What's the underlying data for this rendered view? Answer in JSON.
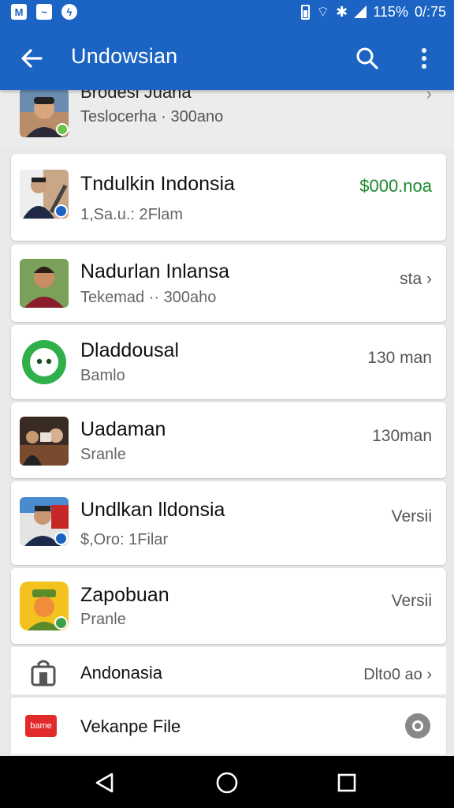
{
  "status_bar": {
    "battery": "115%",
    "time": "0/:75"
  },
  "app_bar": {
    "title": "Undowsian"
  },
  "background_item": {
    "name": "Brodesi Juana",
    "subtitle": "Teslocerha · 300ano",
    "trailing": "›"
  },
  "items": [
    {
      "name": "Tndulkin Indonsia",
      "subtitle": "1,Sa.u.: 2Flam",
      "trailing": "$000.noa",
      "badge_color": "#1b64c4"
    },
    {
      "name": "Nadurlan Inlansa",
      "subtitle": "Tekemad ·· 300aho",
      "trailing": "sta ›"
    },
    {
      "name": "Dladdousal",
      "subtitle": "Bamlo",
      "trailing": "130 man"
    },
    {
      "name": "Uadaman",
      "subtitle": "Sranle",
      "trailing": "130man"
    },
    {
      "name": "Undlkan lldonsia",
      "subtitle": "$,Oro: 1Filar",
      "trailing": "Versii",
      "badge_color": "#1b64c4"
    },
    {
      "name": "Zapobuan",
      "subtitle": "Pranle",
      "trailing": "Versii",
      "badge_color": "#3aa04a"
    }
  ],
  "rows": [
    {
      "name": "Andonasia",
      "trailing": "Dlto0 ao ›",
      "icon": "shopping-bag-icon"
    },
    {
      "name": "Vekanpe File",
      "icon_text": "bame"
    }
  ],
  "colors": {
    "primary": "#1b64c4",
    "price_green": "#1b8a2e",
    "app_green": "#2fb04a"
  }
}
